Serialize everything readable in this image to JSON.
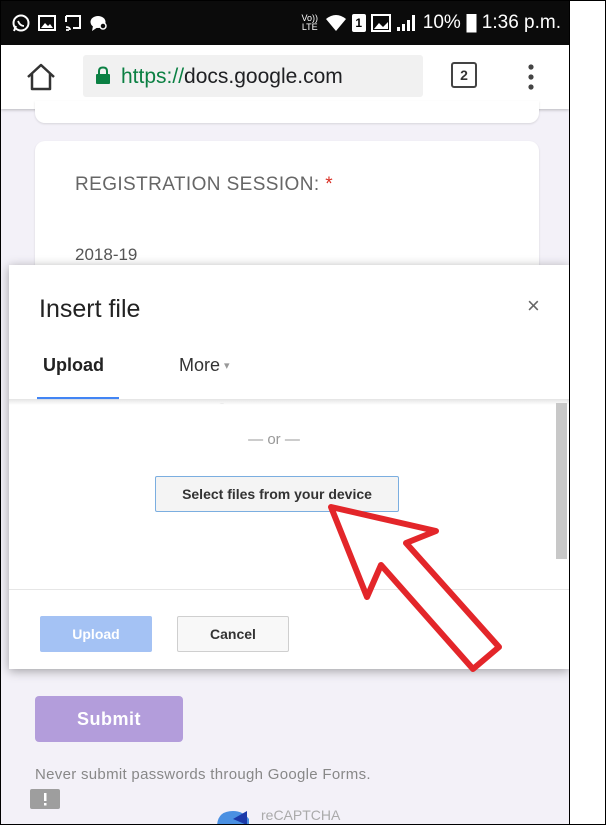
{
  "status_bar": {
    "battery_percent": "10%",
    "time": "1:36 p.m.",
    "network_label": "Vo)) LTE",
    "sim_label": "1"
  },
  "browser": {
    "url_scheme": "https://",
    "url_host": "docs.google.com",
    "tab_count": "2"
  },
  "form": {
    "question_label": "REGISTRATION SESSION:",
    "required_mark": " *",
    "answer": "2018-19",
    "submit_label": "Submit",
    "password_warning": "Never submit passwords through Google Forms.",
    "recaptcha_label": "reCAPTCHA"
  },
  "dialog": {
    "title": "Insert file",
    "close_glyph": "×",
    "tabs": [
      {
        "label": "Upload",
        "selected": true
      },
      {
        "label": "More",
        "caret": "▾",
        "selected": false
      }
    ],
    "or_text": "— or —",
    "select_files_label": "Select files from your device",
    "upload_label": "Upload",
    "cancel_label": "Cancel"
  },
  "colors": {
    "status_bar": "#0b0b0b",
    "secure_green": "#0b8043",
    "tab_indicator": "#4285f4",
    "upload_disabled": "#a4c2f4",
    "submit_purple": "#b39ddb",
    "annotation_arrow": "#e3262a",
    "required_red": "#d93025"
  },
  "icons": {
    "status_left": [
      "whatsapp-icon",
      "gallery-icon",
      "cast-icon",
      "chat-bubble-icon"
    ],
    "status_right": [
      "wifi-icon",
      "sim-icon",
      "image-icon",
      "signal-icon",
      "battery-icon"
    ],
    "browser": [
      "home-icon",
      "lock-icon",
      "tab-switcher-icon",
      "overflow-menu-icon"
    ],
    "dialog": [
      "close-icon",
      "caret-down-icon"
    ],
    "page": [
      "feedback-icon",
      "recaptcha-icon",
      "red-arrow-annotation"
    ]
  }
}
